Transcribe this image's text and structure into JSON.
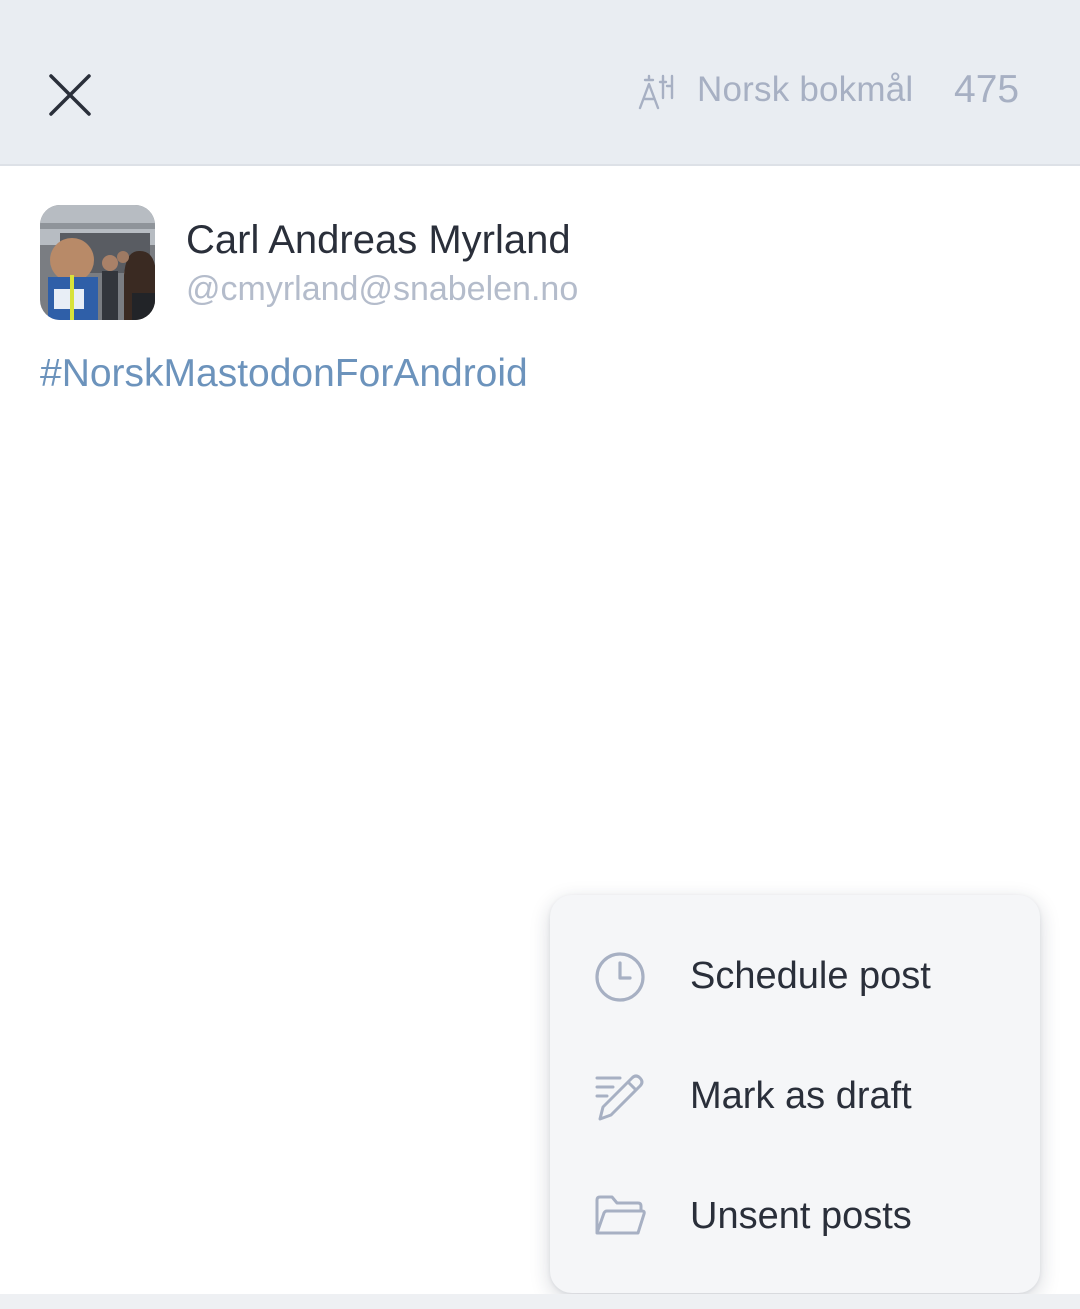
{
  "header": {
    "close_icon": "close-icon",
    "language_icon": "translate-icon",
    "language": "Norsk bokmål",
    "char_count": "475"
  },
  "author": {
    "display_name": "Carl Andreas Myrland",
    "handle": "@cmyrland@snabelen.no"
  },
  "post": {
    "text": "#NorskMastodonForAndroid"
  },
  "menu": {
    "items": [
      {
        "icon": "clock-icon",
        "label": "Schedule post"
      },
      {
        "icon": "draft-pencil-icon",
        "label": "Mark as draft"
      },
      {
        "icon": "folder-icon",
        "label": "Unsent posts"
      }
    ]
  },
  "colors": {
    "header_bg": "#e9edf2",
    "muted_text": "#a7b0c3",
    "hashtag": "#6c93bc",
    "menu_bg": "#f5f6f8"
  }
}
